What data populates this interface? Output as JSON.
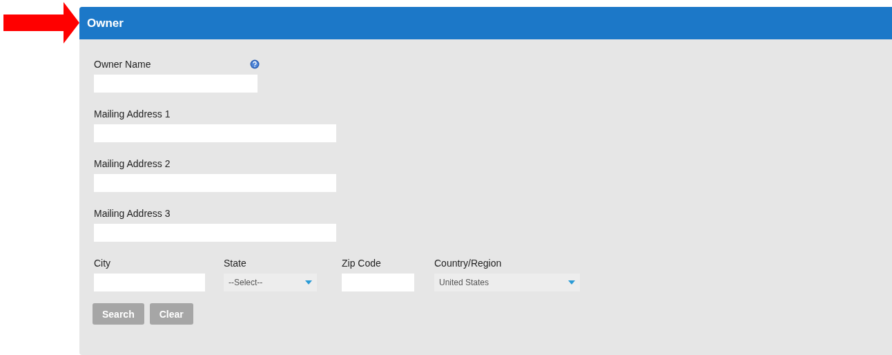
{
  "panel": {
    "title": "Owner"
  },
  "fields": [
    {
      "label": "Owner Name",
      "help": true
    },
    {
      "label": "Mailing Address 1",
      "help": false
    },
    {
      "label": "Mailing Address 2",
      "help": false
    },
    {
      "label": "Mailing Address 3",
      "help": false
    }
  ],
  "location": [
    {
      "kind": "input",
      "label": "City"
    },
    {
      "kind": "select",
      "label": "State",
      "value": "--Select--"
    },
    {
      "kind": "input",
      "label": "Zip Code"
    },
    {
      "kind": "select",
      "label": "Country/Region",
      "value": "United States"
    }
  ],
  "buttons": [
    {
      "label": "Search",
      "disabled": true
    },
    {
      "label": "Clear",
      "disabled": true
    }
  ]
}
